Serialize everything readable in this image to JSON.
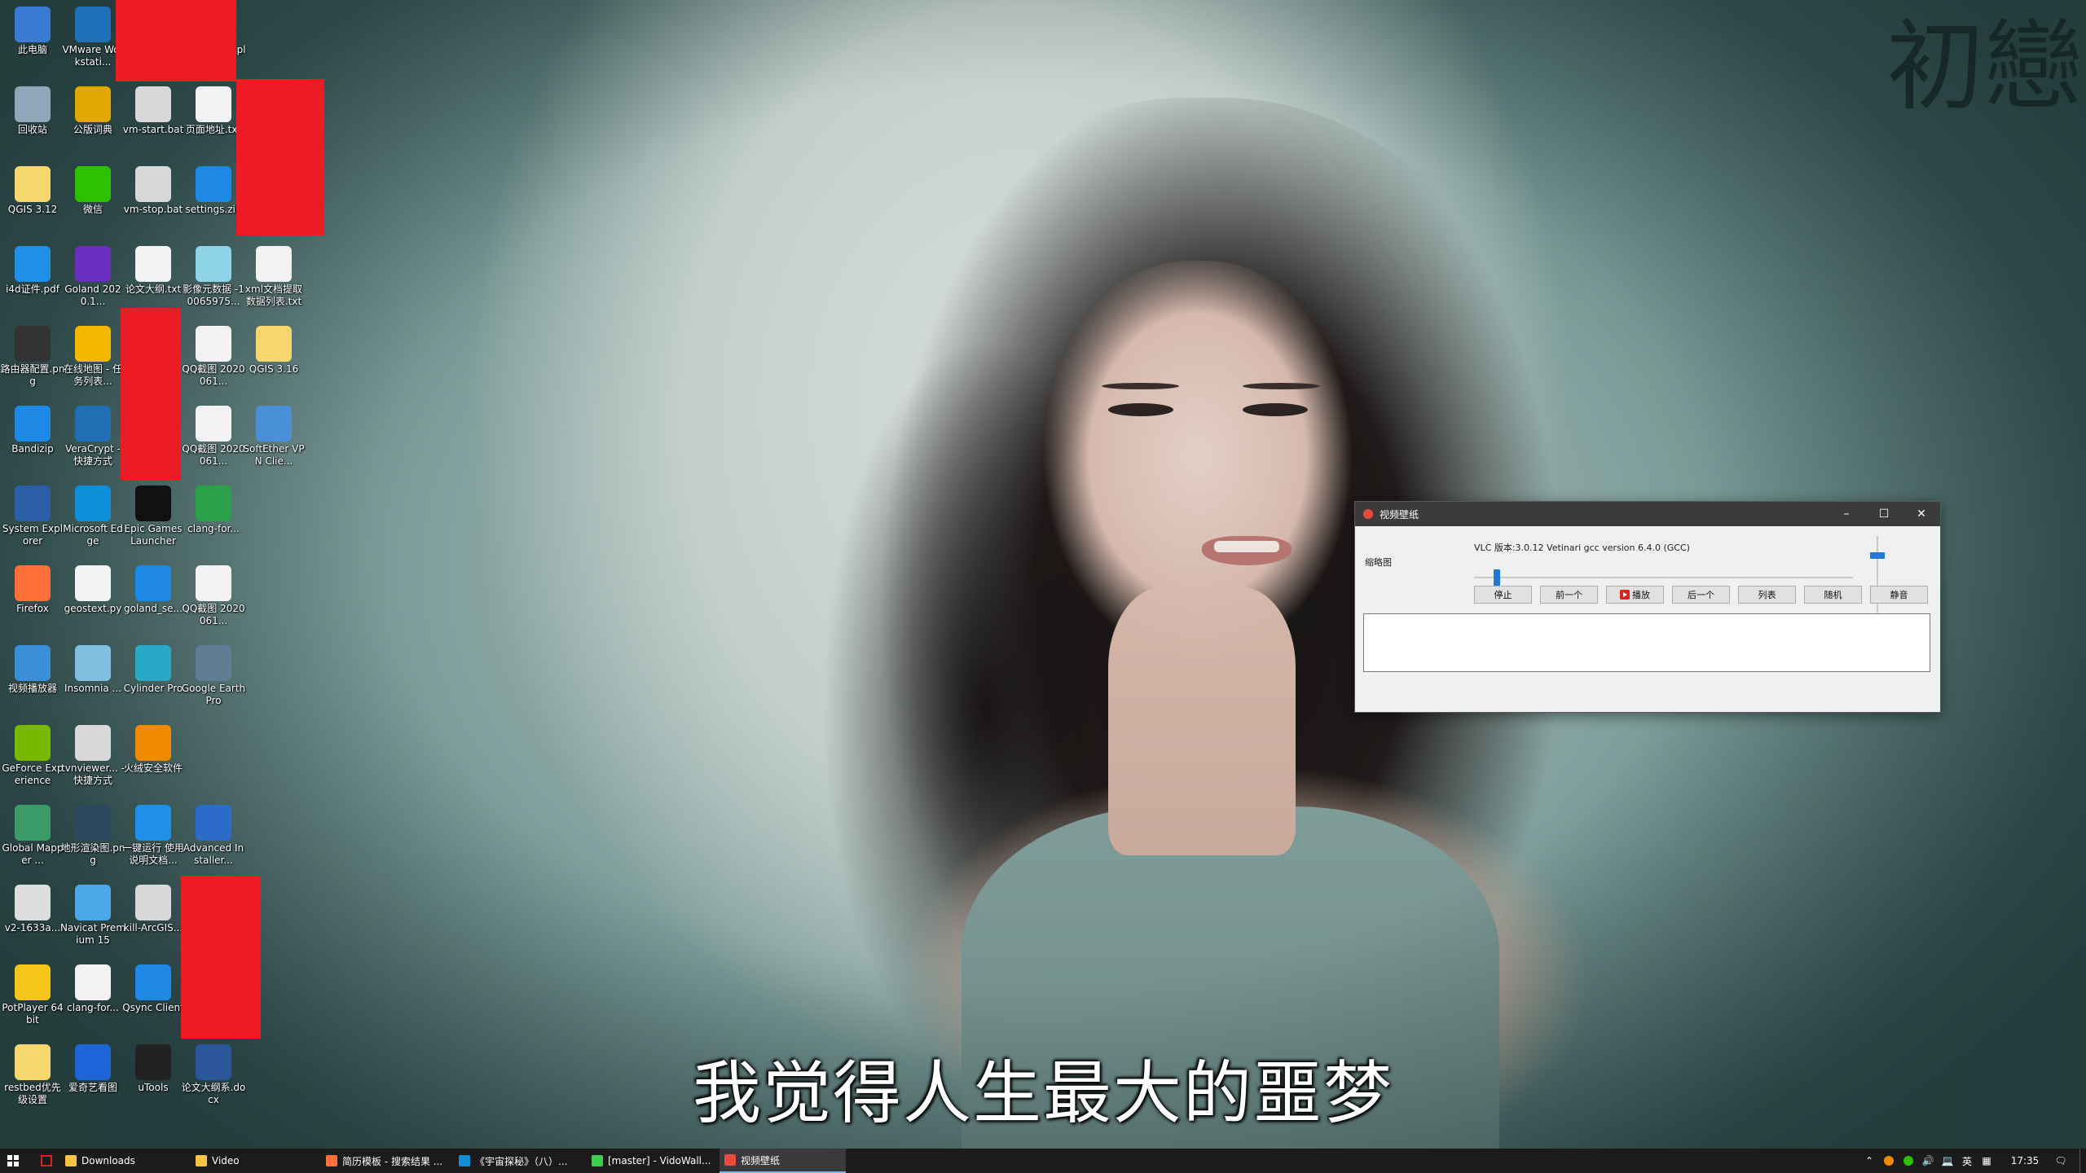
{
  "wallpaper": {
    "calligraphy": "初戀",
    "subtitle": "我觉得人生最大的噩梦"
  },
  "desktop_icons": [
    {
      "label": "此电脑",
      "icon": "computer-icon",
      "color": "#3a7bd5"
    },
    {
      "label": "VMware Workstati...",
      "icon": "vmware-icon",
      "color": "#1d6fb8"
    },
    {
      "label": "VLC media player",
      "icon": "vlc-icon",
      "color": "#f08a00"
    },
    {
      "label": "回收站",
      "icon": "recycle-bin-icon",
      "color": "#8fa7b8"
    },
    {
      "label": "公版词典",
      "icon": "dictionary-icon",
      "color": "#e0a800"
    },
    {
      "label": "vm-start.bat",
      "icon": "batch-file-icon",
      "color": "#d8d8d8"
    },
    {
      "label": "页面地址.txt",
      "icon": "text-file-icon",
      "color": "#f2f2f2"
    },
    {
      "label": "QGIS 3.12",
      "icon": "folder-icon",
      "color": "#f5d76e"
    },
    {
      "label": "微信",
      "icon": "wechat-icon",
      "color": "#2dc100"
    },
    {
      "label": "vm-stop.bat",
      "icon": "batch-file-icon",
      "color": "#d8d8d8"
    },
    {
      "label": "settings.zip",
      "icon": "bandizip-archive-icon",
      "color": "#1e88e5"
    },
    {
      "label": "i4d证件.pdf",
      "icon": "pdf-icon",
      "color": "#1e90e8"
    },
    {
      "label": "Goland 2020.1...",
      "icon": "goland-icon",
      "color": "#6b2fbf"
    },
    {
      "label": "论文大纲.txt",
      "icon": "text-file-icon",
      "color": "#f2f2f2"
    },
    {
      "label": "影像元数据 -10065975...",
      "icon": "document-icon",
      "color": "#8fd3e8"
    },
    {
      "label": "xml文档提取 数据列表.txt",
      "icon": "text-file-icon",
      "color": "#f2f2f2"
    },
    {
      "label": "路由器配置.png",
      "icon": "image-file-icon",
      "color": "#333333"
    },
    {
      "label": "在线地图 - 任务列表...",
      "icon": "pizza-map-icon",
      "color": "#f5b800"
    },
    {
      "label": "QQ截图 2020061...",
      "icon": "image-file-icon",
      "color": "#f2f2f2"
    },
    {
      "label": "QGIS 3.16",
      "icon": "folder-icon",
      "color": "#f5d76e"
    },
    {
      "label": "Bandizip",
      "icon": "bandizip-icon",
      "color": "#1e88e5"
    },
    {
      "label": "VeraCrypt - 快捷方式",
      "icon": "veracrypt-icon",
      "color": "#1f6fb2"
    },
    {
      "label": "QQ截图 2020061...",
      "icon": "image-file-icon",
      "color": "#f2f2f2"
    },
    {
      "label": "SoftEther VPN Clie...",
      "icon": "softether-icon",
      "color": "#4a90d9"
    },
    {
      "label": "System Explorer",
      "icon": "system-explorer-icon",
      "color": "#2a5fa8"
    },
    {
      "label": "Microsoft Edge",
      "icon": "edge-icon",
      "color": "#0f8fd8"
    },
    {
      "label": "Epic Games Launcher",
      "icon": "epic-games-icon",
      "color": "#111111"
    },
    {
      "label": "clang-for...",
      "icon": "archive-7z-icon",
      "color": "#2aa04a"
    },
    {
      "label": "Firefox",
      "icon": "firefox-icon",
      "color": "#ff7139"
    },
    {
      "label": "geostext.py",
      "icon": "python-file-icon",
      "color": "#f2f2f2"
    },
    {
      "label": "goland_se...",
      "icon": "bandizip-archive-icon",
      "color": "#1e88e5"
    },
    {
      "label": "QQ截图 2020061...",
      "icon": "image-file-icon",
      "color": "#f2f2f2"
    },
    {
      "label": "视频播放器",
      "icon": "video-player-icon",
      "color": "#3b8fd9"
    },
    {
      "label": "Insomnia ...",
      "icon": "insomnia-icon",
      "color": "#7fc0e0"
    },
    {
      "label": "Cylinder Pro",
      "icon": "cylinder-icon",
      "color": "#2aa8c8"
    },
    {
      "label": "Google Earth Pro",
      "icon": "google-earth-icon",
      "color": "#5f7d95"
    },
    {
      "label": "GeForce Experience",
      "icon": "geforce-icon",
      "color": "#76b900"
    },
    {
      "label": "tvnviewer... - 快捷方式",
      "icon": "vnc-icon",
      "color": "#d8d8d8"
    },
    {
      "label": "火绒安全软件",
      "icon": "huorong-icon",
      "color": "#f08a00"
    },
    {
      "label": "Global Mapper ...",
      "icon": "global-mapper-icon",
      "color": "#3b9c6a"
    },
    {
      "label": "地形渲染图.png",
      "icon": "image-file-icon",
      "color": "#2c4860"
    },
    {
      "label": "一键运行 使用说明文档...",
      "icon": "app-icon",
      "color": "#1e90e8"
    },
    {
      "label": "Advanced Installer...",
      "icon": "advanced-installer-icon",
      "color": "#2a6cc8"
    },
    {
      "label": "v2-1633a...",
      "icon": "image-file-icon",
      "color": "#dddddd"
    },
    {
      "label": "Navicat Premium 15",
      "icon": "navicat-icon",
      "color": "#4aa8e8"
    },
    {
      "label": "kill-ArcGIS...",
      "icon": "batch-file-icon",
      "color": "#d8d8d8"
    },
    {
      "label": "PotPlayer 64 bit",
      "icon": "potplayer-icon",
      "color": "#f5c518"
    },
    {
      "label": "clang-for...",
      "icon": "text-file-icon",
      "color": "#f2f2f2"
    },
    {
      "label": "Qsync Client",
      "icon": "qsync-icon",
      "color": "#1e88e5"
    },
    {
      "label": "restbed优先级设置",
      "icon": "folder-icon",
      "color": "#f5d76e"
    },
    {
      "label": "爱奇艺看图",
      "icon": "image-viewer-icon",
      "color": "#1e63d8"
    },
    {
      "label": "uTools",
      "icon": "utools-icon",
      "color": "#222222"
    },
    {
      "label": "论文大纲系.docx",
      "icon": "word-doc-icon",
      "color": "#2b579a"
    }
  ],
  "app_window": {
    "title": "视频壁纸",
    "version_text": "VLC 版本:3.0.12 Vetinari gcc version 6.4.0 (GCC)",
    "thumbnail_label": "缩略图",
    "buttons": {
      "stop": "停止",
      "prev": "前一个",
      "play": "播放",
      "next": "后一个",
      "list": "列表",
      "random": "随机",
      "mute": "静音"
    },
    "progress_fraction": 0.06,
    "volume_fraction": 0.75,
    "accent_color": "#1e78d7"
  },
  "taskbar": {
    "items": [
      {
        "label": "Downloads",
        "icon": "folder-icon",
        "color": "#f5c542"
      },
      {
        "label": "Video",
        "icon": "folder-icon",
        "color": "#f5c542"
      },
      {
        "label": "简历模板 - 搜索结果 ...",
        "icon": "firefox-icon",
        "color": "#ff7139"
      },
      {
        "label": "《宇宙探秘》（八）...",
        "icon": "edge-icon",
        "color": "#0f8fd8"
      },
      {
        "label": "[master] - VidoWall...",
        "icon": "qt-creator-icon",
        "color": "#41cd52"
      },
      {
        "label": "视频壁纸",
        "icon": "video-wallpaper-icon",
        "color": "#e84a3c"
      }
    ],
    "tray": {
      "ime": "英",
      "time": "17:35"
    }
  }
}
